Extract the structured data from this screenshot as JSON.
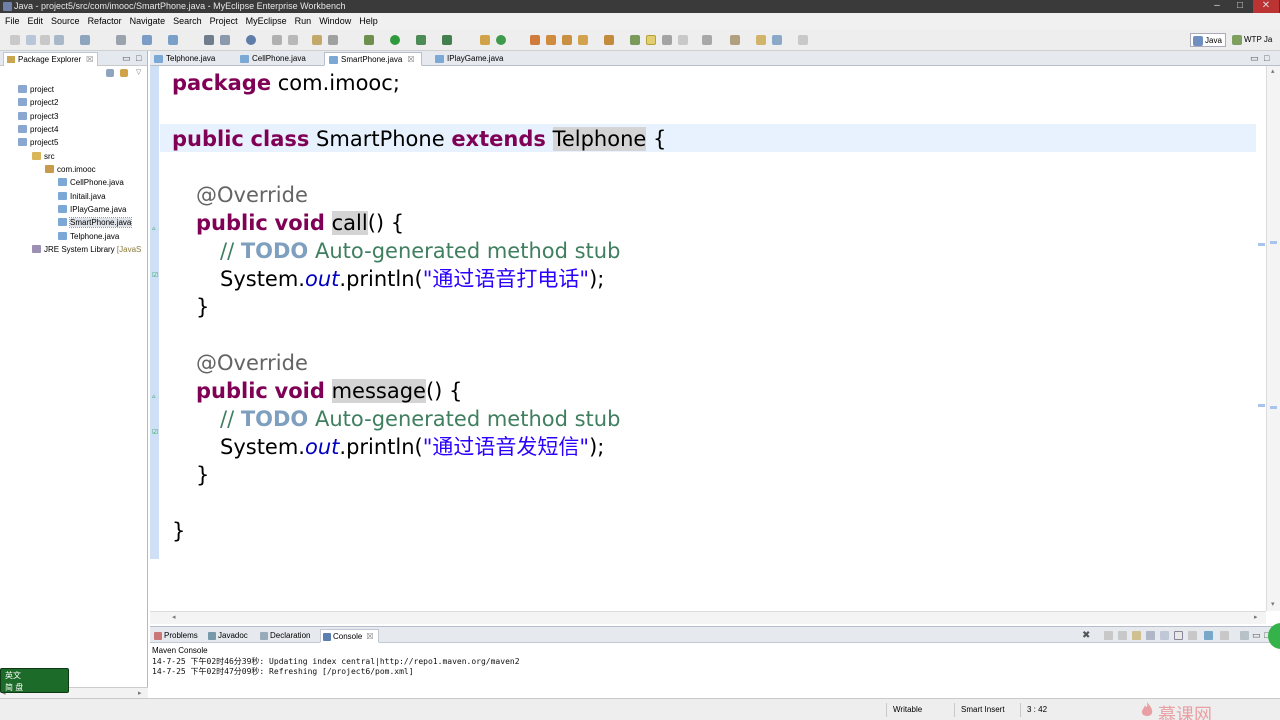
{
  "window": {
    "title": "Java - project5/src/com/imooc/SmartPhone.java - MyEclipse Enterprise Workbench",
    "minimize": "–",
    "maximize": "□",
    "close": "✕"
  },
  "menu": [
    "File",
    "Edit",
    "Source",
    "Refactor",
    "Navigate",
    "Search",
    "Project",
    "MyEclipse",
    "Run",
    "Window",
    "Help"
  ],
  "perspectives": {
    "java": "Java",
    "wtp": "WTP Ja"
  },
  "explorer": {
    "title": "Package Explorer",
    "close": "☒",
    "items": [
      {
        "label": "project"
      },
      {
        "label": "project2"
      },
      {
        "label": "project3"
      },
      {
        "label": "project4"
      },
      {
        "label": "project5"
      },
      {
        "label": "src"
      },
      {
        "label": "com.imooc"
      },
      {
        "label": "CellPhone.java"
      },
      {
        "label": "Initail.java"
      },
      {
        "label": "IPlayGame.java"
      },
      {
        "label": "SmartPhone.java"
      },
      {
        "label": "Telphone.java"
      },
      {
        "label": "JRE System Library",
        "sub": "[JavaS"
      }
    ]
  },
  "editor": {
    "tabs": [
      {
        "label": "Telphone.java"
      },
      {
        "label": "CellPhone.java"
      },
      {
        "label": "SmartPhone.java",
        "close": "☒"
      },
      {
        "label": "IPlayGame.java"
      }
    ],
    "code": {
      "l1_kw": "package",
      "l1_rest": " com.imooc;",
      "l2_kw1": "public",
      "l2_kw2": "class",
      "l2_name": " SmartPhone ",
      "l2_kw3": "extends",
      "l2_super": "Telphone",
      "l2_end": " {",
      "l3_ann": "@Override",
      "l4_kw1": "public",
      "l4_kw2": "void",
      "l4_method": "call",
      "l4_end": "() {",
      "l5_slash": "// ",
      "l5_todo": "TODO",
      "l5_rest": " Auto-generated method stub",
      "l6_pre": "System.",
      "l6_field": "out",
      "l6_mid": ".println(",
      "l6_str": "\"通过语音打电话\"",
      "l6_end": ");",
      "l7": "}",
      "l8_ann": "@Override",
      "l9_kw1": "public",
      "l9_kw2": "void",
      "l9_method": "message",
      "l9_end": "() {",
      "l10_slash": "// ",
      "l10_todo": "TODO",
      "l10_rest": " Auto-generated method stub",
      "l11_pre": "System.",
      "l11_field": "out",
      "l11_mid": ".println(",
      "l11_str": "\"通过语音发短信\"",
      "l11_end": ");",
      "l12": "}",
      "l13": "}"
    }
  },
  "bottom": {
    "tabs": [
      {
        "label": "Problems"
      },
      {
        "label": "Javadoc"
      },
      {
        "label": "Declaration"
      },
      {
        "label": "Console",
        "close": "☒"
      }
    ],
    "console_title": "Maven Console",
    "lines": [
      "14-7-25 下午02时46分39秒: Updating index central|http://repo1.maven.org/maven2",
      "14-7-25 下午02时47分09秒: Refreshing [/project6/pom.xml]"
    ]
  },
  "ime": {
    "mode": "英文",
    "simp": "简 盘"
  },
  "status": {
    "writable": "Writable",
    "insert": "Smart Insert",
    "position": "3 : 42"
  },
  "watermark": "慕课网",
  "colors": {
    "keyword": "#7f0055",
    "comment": "#3f7f5f",
    "string": "#2a00ff",
    "annotation": "#646464",
    "current_line": "#e8f2fe"
  }
}
